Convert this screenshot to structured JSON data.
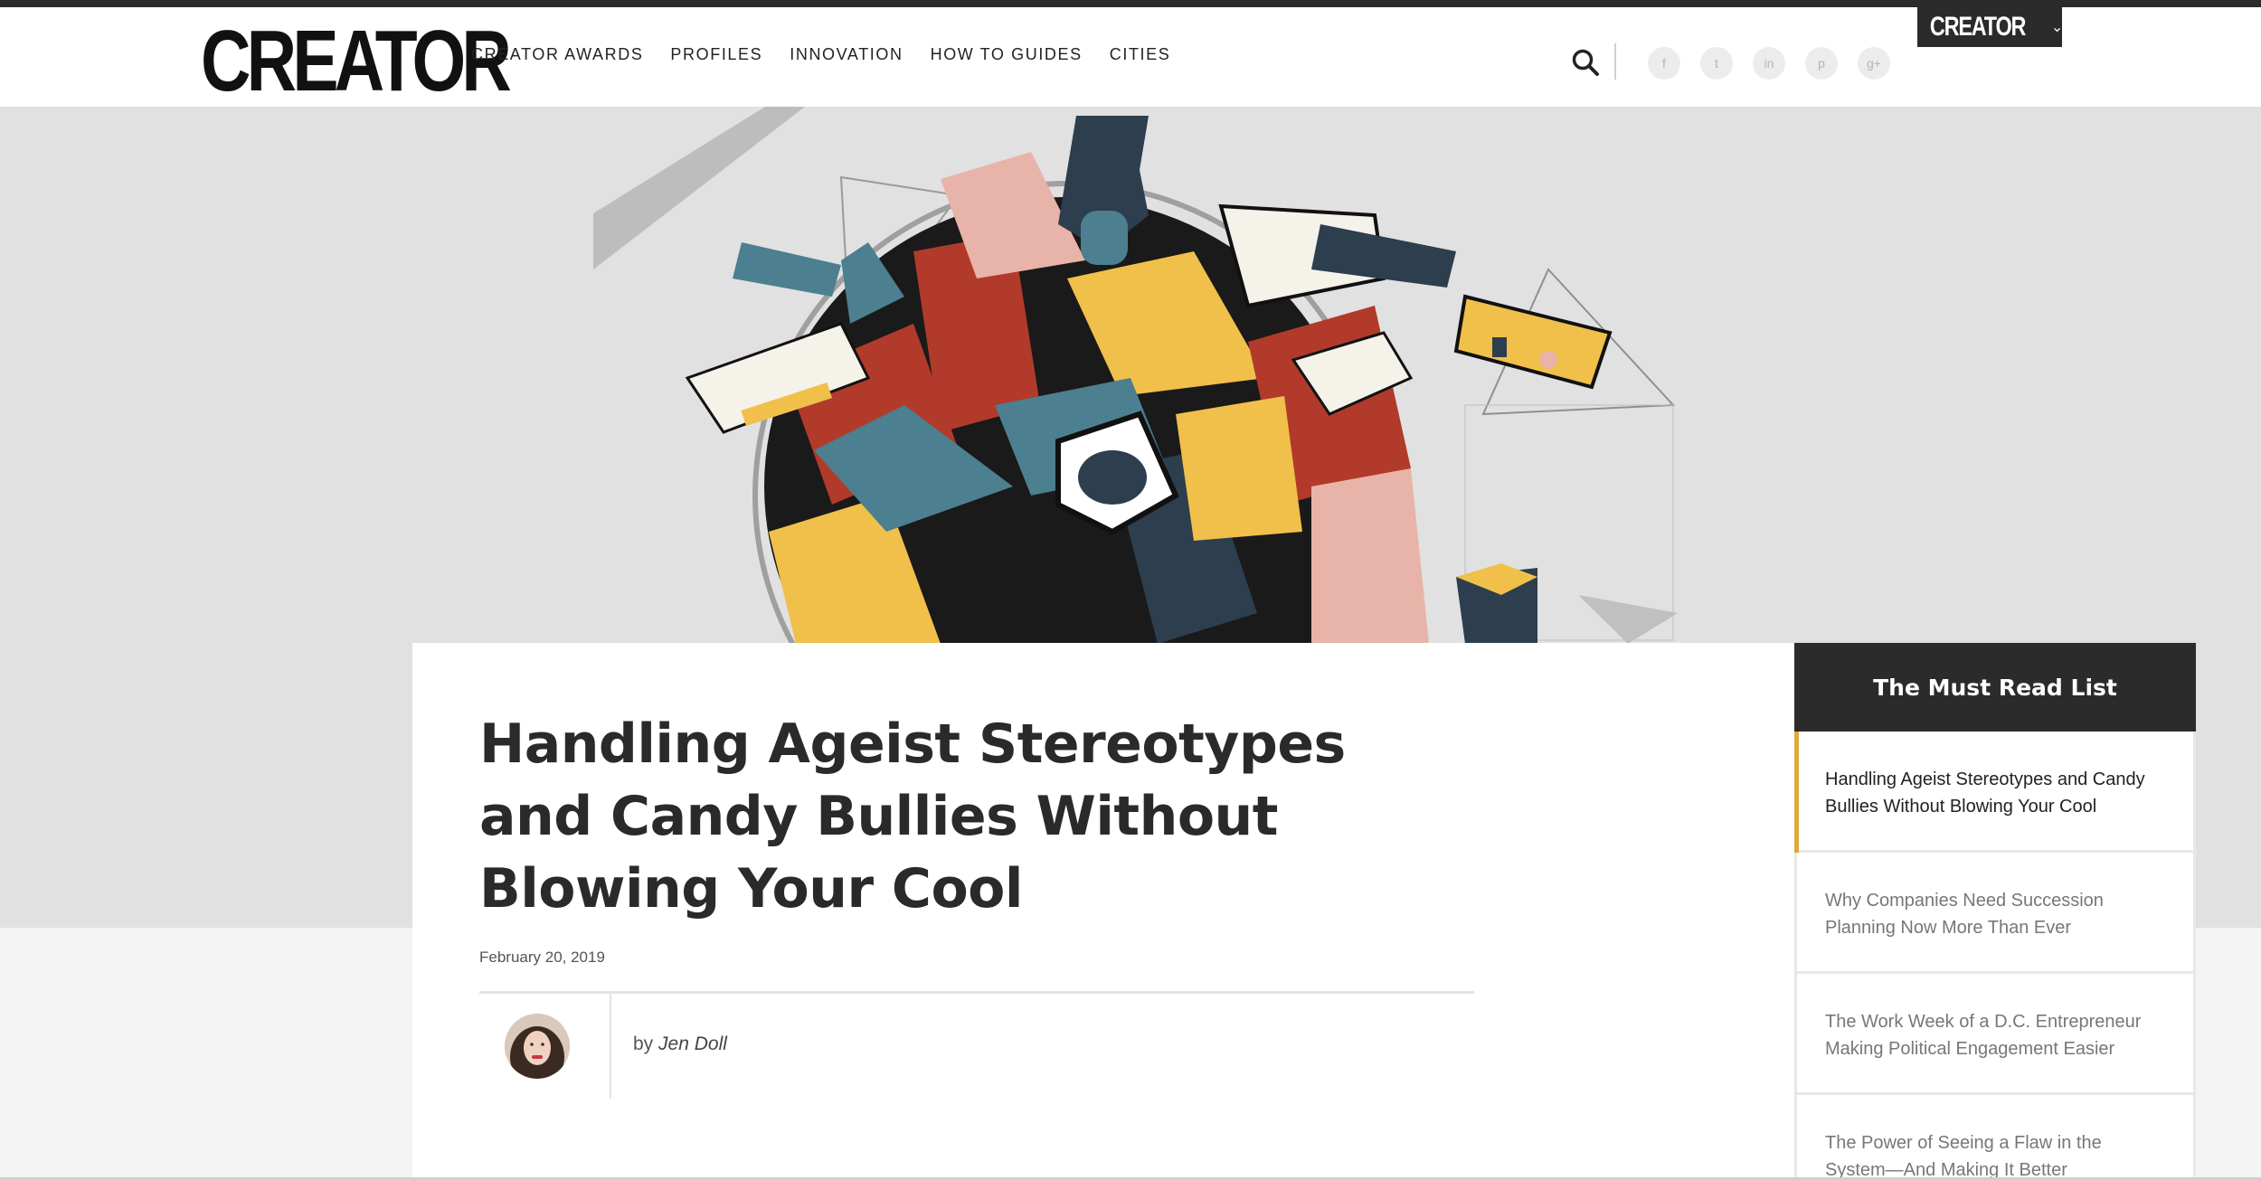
{
  "site": {
    "logo": "CREATOR",
    "brand_dropdown_label": "CREATOR",
    "brand_dropdown_chevron": "⌄"
  },
  "nav": {
    "items": [
      "CREATOR AWARDS",
      "PROFILES",
      "INNOVATION",
      "HOW TO GUIDES",
      "CITIES"
    ]
  },
  "icons": {
    "search": "search-icon",
    "social": [
      {
        "name": "facebook-icon",
        "glyph": "f"
      },
      {
        "name": "twitter-icon",
        "glyph": "t"
      },
      {
        "name": "linkedin-icon",
        "glyph": "in"
      },
      {
        "name": "pinterest-icon",
        "glyph": "p"
      },
      {
        "name": "google-plus-icon",
        "glyph": "g+"
      }
    ]
  },
  "article": {
    "title": "Handling Ageist Stereotypes and Candy Bullies Without Blowing Your Cool",
    "date": "February 20, 2019",
    "by_prefix": "by",
    "author": "Jen Doll"
  },
  "must_read": {
    "heading": "The Must Read List",
    "items": [
      "Handling Ageist Stereotypes and Candy Bullies Without Blowing Your Cool",
      "Why Companies Need Succession Planning Now More Than Ever",
      "The Work Week of a D.C. Entrepreneur Making Political Engagement Easier",
      "The Power of Seeing a Flaw in the System—And Making It Better"
    ]
  },
  "colors": {
    "dark": "#2b2b2b",
    "accent": "#e0a93a",
    "hero_bg": "#e1e1e1",
    "candy_yellow": "#f0c04a",
    "candy_red": "#b23a2b",
    "candy_teal": "#4c7f8f",
    "candy_navy": "#2d3e4e",
    "candy_pink": "#e8b3a8"
  }
}
